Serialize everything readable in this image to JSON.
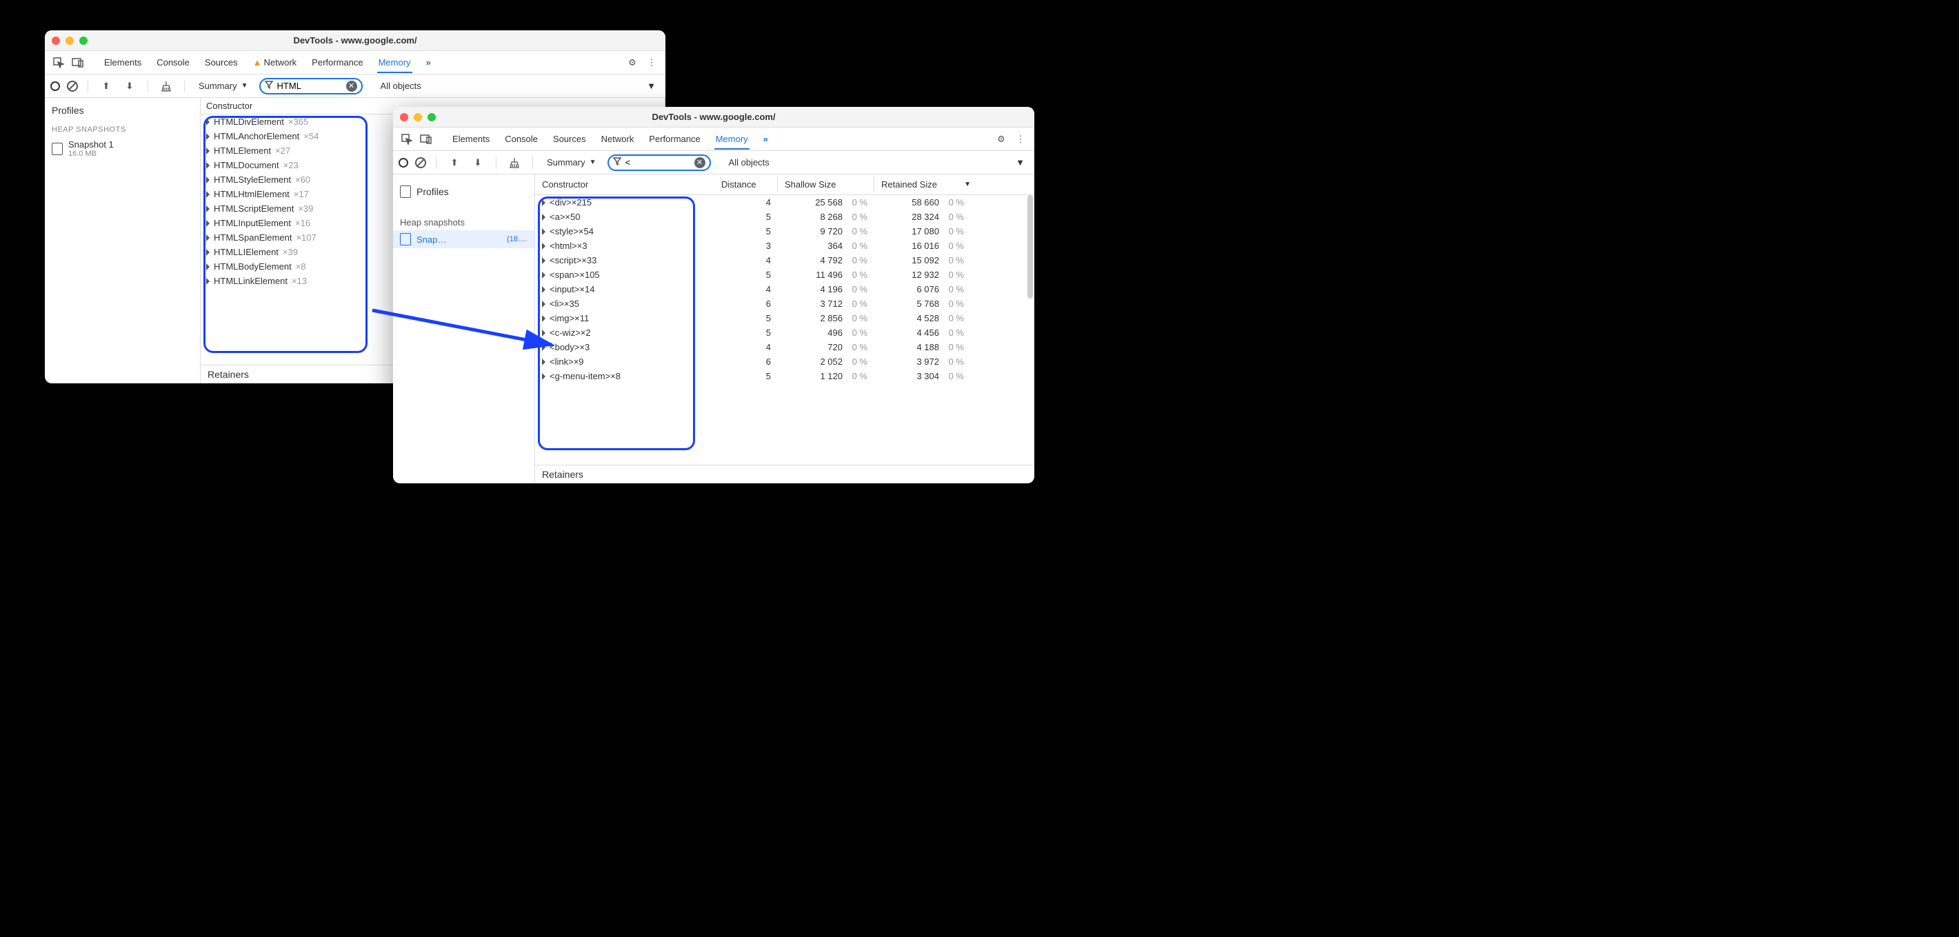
{
  "window1": {
    "title": "DevTools - www.google.com/",
    "tabs": [
      "Elements",
      "Console",
      "Sources",
      "Network",
      "Performance",
      "Memory"
    ],
    "active_tab": "Memory",
    "has_network_warning": true,
    "toolbar": {
      "summary_label": "Summary",
      "filter_value": "HTML",
      "all_objects_label": "All objects"
    },
    "sidebar": {
      "profiles_label": "Profiles",
      "section_label": "HEAP SNAPSHOTS",
      "item_name": "Snapshot 1",
      "item_size": "16.0 MB"
    },
    "constructor_header": "Constructor",
    "constructors": [
      {
        "name": "HTMLDivElement",
        "count": "×365"
      },
      {
        "name": "HTMLAnchorElement",
        "count": "×54"
      },
      {
        "name": "HTMLElement",
        "count": "×27"
      },
      {
        "name": "HTMLDocument",
        "count": "×23"
      },
      {
        "name": "HTMLStyleElement",
        "count": "×60"
      },
      {
        "name": "HTMLHtmlElement",
        "count": "×17"
      },
      {
        "name": "HTMLScriptElement",
        "count": "×39"
      },
      {
        "name": "HTMLInputElement",
        "count": "×16"
      },
      {
        "name": "HTMLSpanElement",
        "count": "×107"
      },
      {
        "name": "HTMLLIElement",
        "count": "×39"
      },
      {
        "name": "HTMLBodyElement",
        "count": "×8"
      },
      {
        "name": "HTMLLinkElement",
        "count": "×13"
      }
    ],
    "retainers_label": "Retainers"
  },
  "window2": {
    "title": "DevTools - www.google.com/",
    "tabs": [
      "Elements",
      "Console",
      "Sources",
      "Network",
      "Performance",
      "Memory"
    ],
    "active_tab": "Memory",
    "toolbar": {
      "summary_label": "Summary",
      "filter_value": "<",
      "all_objects_label": "All objects"
    },
    "sidebar": {
      "profiles_label": "Profiles",
      "section_label": "Heap snapshots",
      "item_name": "Snap…",
      "item_size": "(18.…"
    },
    "headers": {
      "constructor": "Constructor",
      "distance": "Distance",
      "shallow": "Shallow Size",
      "retained": "Retained Size"
    },
    "rows": [
      {
        "name": "<div>",
        "count": "×215",
        "dist": "4",
        "shallow": "25 568",
        "shpc": "0 %",
        "ret": "58 660",
        "rpc": "0 %"
      },
      {
        "name": "<a>",
        "count": "×50",
        "dist": "5",
        "shallow": "8 268",
        "shpc": "0 %",
        "ret": "28 324",
        "rpc": "0 %"
      },
      {
        "name": "<style>",
        "count": "×54",
        "dist": "5",
        "shallow": "9 720",
        "shpc": "0 %",
        "ret": "17 080",
        "rpc": "0 %"
      },
      {
        "name": "<html>",
        "count": "×3",
        "dist": "3",
        "shallow": "364",
        "shpc": "0 %",
        "ret": "16 016",
        "rpc": "0 %"
      },
      {
        "name": "<script>",
        "count": "×33",
        "dist": "4",
        "shallow": "4 792",
        "shpc": "0 %",
        "ret": "15 092",
        "rpc": "0 %"
      },
      {
        "name": "<span>",
        "count": "×105",
        "dist": "5",
        "shallow": "11 496",
        "shpc": "0 %",
        "ret": "12 932",
        "rpc": "0 %"
      },
      {
        "name": "<input>",
        "count": "×14",
        "dist": "4",
        "shallow": "4 196",
        "shpc": "0 %",
        "ret": "6 076",
        "rpc": "0 %"
      },
      {
        "name": "<li>",
        "count": "×35",
        "dist": "6",
        "shallow": "3 712",
        "shpc": "0 %",
        "ret": "5 768",
        "rpc": "0 %"
      },
      {
        "name": "<img>",
        "count": "×11",
        "dist": "5",
        "shallow": "2 856",
        "shpc": "0 %",
        "ret": "4 528",
        "rpc": "0 %"
      },
      {
        "name": "<c-wiz>",
        "count": "×2",
        "dist": "5",
        "shallow": "496",
        "shpc": "0 %",
        "ret": "4 456",
        "rpc": "0 %"
      },
      {
        "name": "<body>",
        "count": "×3",
        "dist": "4",
        "shallow": "720",
        "shpc": "0 %",
        "ret": "4 188",
        "rpc": "0 %"
      },
      {
        "name": "<link>",
        "count": "×9",
        "dist": "6",
        "shallow": "2 052",
        "shpc": "0 %",
        "ret": "3 972",
        "rpc": "0 %"
      },
      {
        "name": "<g-menu-item>",
        "count": "×8",
        "dist": "5",
        "shallow": "1 120",
        "shpc": "0 %",
        "ret": "3 304",
        "rpc": "0 %"
      }
    ],
    "retainers_label": "Retainers"
  }
}
